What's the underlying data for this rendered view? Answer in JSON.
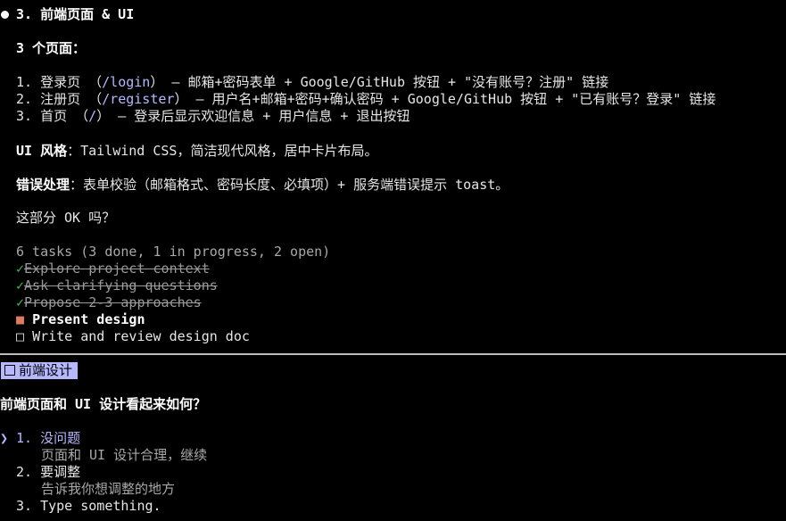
{
  "section": {
    "heading": "3. 前端页面 & UI",
    "pages_count": "3 个页面：",
    "pages": [
      {
        "num": "1.",
        "name": "登录页",
        "path_open": "（",
        "path": "/login",
        "path_close": "）",
        "desc": " – 邮箱+密码表单 + Google/GitHub 按钮 + \"没有账号？注册\" 链接"
      },
      {
        "num": "2.",
        "name": "注册页",
        "path_open": "（",
        "path": "/register",
        "path_close": "）",
        "desc": " – 用户名+邮箱+密码+确认密码 + Google/GitHub 按钮 + \"已有账号？登录\" 链接"
      },
      {
        "num": "3.",
        "name": "首页",
        "path_open": "（",
        "path": "/",
        "path_close": "）",
        "desc": " – 登录后显示欢迎信息 + 用户信息 + 退出按钮"
      }
    ],
    "ui_style_label": "UI 风格",
    "ui_style_text": "：Tailwind CSS，简洁现代风格，居中卡片布局。",
    "error_label": "错误处理",
    "error_text": "：表单校验（邮箱格式、密码长度、必填项）+ 服务端错误提示 toast。",
    "question": "这部分 OK 吗？"
  },
  "tasks": {
    "summary": "6 tasks (3 done, 1 in progress, 2 open)",
    "items": [
      {
        "label": "Explore project context",
        "status": "done",
        "marker": "✓"
      },
      {
        "label": "Ask clarifying questions",
        "status": "done",
        "marker": "✓"
      },
      {
        "label": "Propose 2-3 approaches",
        "status": "done",
        "marker": "✓"
      },
      {
        "label": "Present design",
        "status": "in_progress",
        "marker": "■"
      },
      {
        "label": "Write and review design doc",
        "status": "open",
        "marker": "□"
      }
    ]
  },
  "prompt": {
    "tag_label": "前端设计",
    "question": "前端页面和 UI 设计看起来如何？",
    "pointer": "❯",
    "options": [
      {
        "num": "1.",
        "label": "没问题",
        "desc": "页面和 UI 设计合理，继续",
        "selected": true
      },
      {
        "num": "2.",
        "label": "要调整",
        "desc": "告诉我你想调整的地方",
        "selected": false
      },
      {
        "num": "3.",
        "label": "Type something.",
        "desc": "",
        "selected": false
      }
    ]
  },
  "colors": {
    "background": "#000000",
    "accent": "#b6b8ff",
    "done_check": "#3fb950",
    "in_progress": "#e07a5f"
  }
}
